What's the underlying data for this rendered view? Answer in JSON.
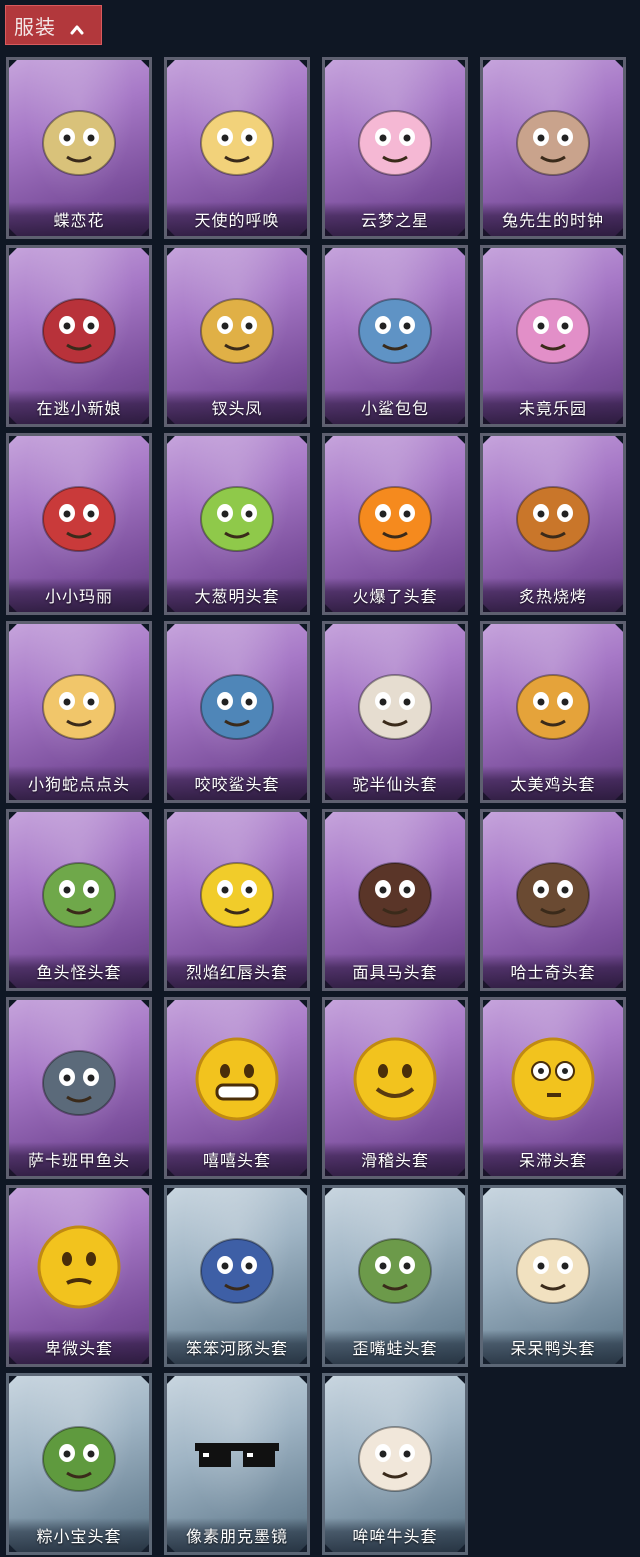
{
  "header": {
    "label": "服装"
  },
  "items": [
    {
      "name": "蝶恋花",
      "theme": "purple",
      "icon": "butterfly-charm-icon",
      "color": "#d9c27a"
    },
    {
      "name": "天使的呼唤",
      "theme": "purple",
      "icon": "angel-figure-icon",
      "color": "#f2d27a"
    },
    {
      "name": "云梦之星",
      "theme": "purple",
      "icon": "unicorn-icon",
      "color": "#f5b8d4"
    },
    {
      "name": "兔先生的时钟",
      "theme": "purple",
      "icon": "rabbit-clock-icon",
      "color": "#c9a38c"
    },
    {
      "name": "在逃小新娘",
      "theme": "purple",
      "icon": "red-lamp-dress-icon",
      "color": "#b8323a"
    },
    {
      "name": "钗头凤",
      "theme": "purple",
      "icon": "phoenix-crown-icon",
      "color": "#e0b046"
    },
    {
      "name": "小鲨包包",
      "theme": "purple",
      "icon": "shark-bag-icon",
      "color": "#5f93c5"
    },
    {
      "name": "未竟乐园",
      "theme": "purple",
      "icon": "doll-figure-icon",
      "color": "#e28fc8"
    },
    {
      "name": "小小玛丽",
      "theme": "purple",
      "icon": "mary-doll-icon",
      "color": "#c93a3a"
    },
    {
      "name": "大葱明头套",
      "theme": "purple",
      "icon": "scallion-head-icon",
      "color": "#8fc94a"
    },
    {
      "name": "火爆了头套",
      "theme": "purple",
      "icon": "fire-head-icon",
      "color": "#f58a1e"
    },
    {
      "name": "炙热烧烤",
      "theme": "purple",
      "icon": "grill-head-icon",
      "color": "#c9762a"
    },
    {
      "name": "小狗蛇点点头",
      "theme": "purple",
      "icon": "snake-head-icon",
      "color": "#f1c66a"
    },
    {
      "name": "咬咬鲨头套",
      "theme": "purple",
      "icon": "shark-head-icon",
      "color": "#4f86b8"
    },
    {
      "name": "驼半仙头套",
      "theme": "purple",
      "icon": "bear-head-icon",
      "color": "#e6ddd0"
    },
    {
      "name": "太美鸡头套",
      "theme": "purple",
      "icon": "chicken-head-icon",
      "color": "#e5a33a"
    },
    {
      "name": "鱼头怪头套",
      "theme": "purple",
      "icon": "fish-head-icon",
      "color": "#6fa84a"
    },
    {
      "name": "烈焰红唇头套",
      "theme": "purple",
      "icon": "pikachu-head-icon",
      "color": "#f1cc2a"
    },
    {
      "name": "面具马头套",
      "theme": "purple",
      "icon": "horse-head-icon",
      "color": "#5a3528"
    },
    {
      "name": "哈士奇头套",
      "theme": "purple",
      "icon": "husky-head-icon",
      "color": "#6a4a32"
    },
    {
      "name": "萨卡班甲鱼头",
      "theme": "purple",
      "icon": "fish-blob-icon",
      "color": "#5b6a7a"
    },
    {
      "name": "嘻嘻头套",
      "theme": "purple",
      "icon": "grin-emoji-icon",
      "color": "#f2c31e"
    },
    {
      "name": "滑稽头套",
      "theme": "purple",
      "icon": "smirk-emoji-icon",
      "color": "#f2c31e"
    },
    {
      "name": "呆滞头套",
      "theme": "purple",
      "icon": "dazed-emoji-icon",
      "color": "#f2c31e"
    },
    {
      "name": "卑微头套",
      "theme": "purple",
      "icon": "humble-emoji-icon",
      "color": "#f2c31e"
    },
    {
      "name": "笨笨河豚头套",
      "theme": "blue",
      "icon": "pufferfish-head-icon",
      "color": "#3e5fa6"
    },
    {
      "name": "歪嘴蛙头套",
      "theme": "blue",
      "icon": "frog-head-icon",
      "color": "#6c9a4a"
    },
    {
      "name": "呆呆鸭头套",
      "theme": "blue",
      "icon": "duck-head-icon",
      "color": "#f1e1c0"
    },
    {
      "name": "粽小宝头套",
      "theme": "blue",
      "icon": "zongzi-head-icon",
      "color": "#5f9a3e"
    },
    {
      "name": "像素朋克墨镜",
      "theme": "blue",
      "icon": "pixel-sunglasses-icon",
      "color": "#1a1a1a"
    },
    {
      "name": "哞哞牛头套",
      "theme": "blue",
      "icon": "cow-head-icon",
      "color": "#f1e7da"
    }
  ]
}
